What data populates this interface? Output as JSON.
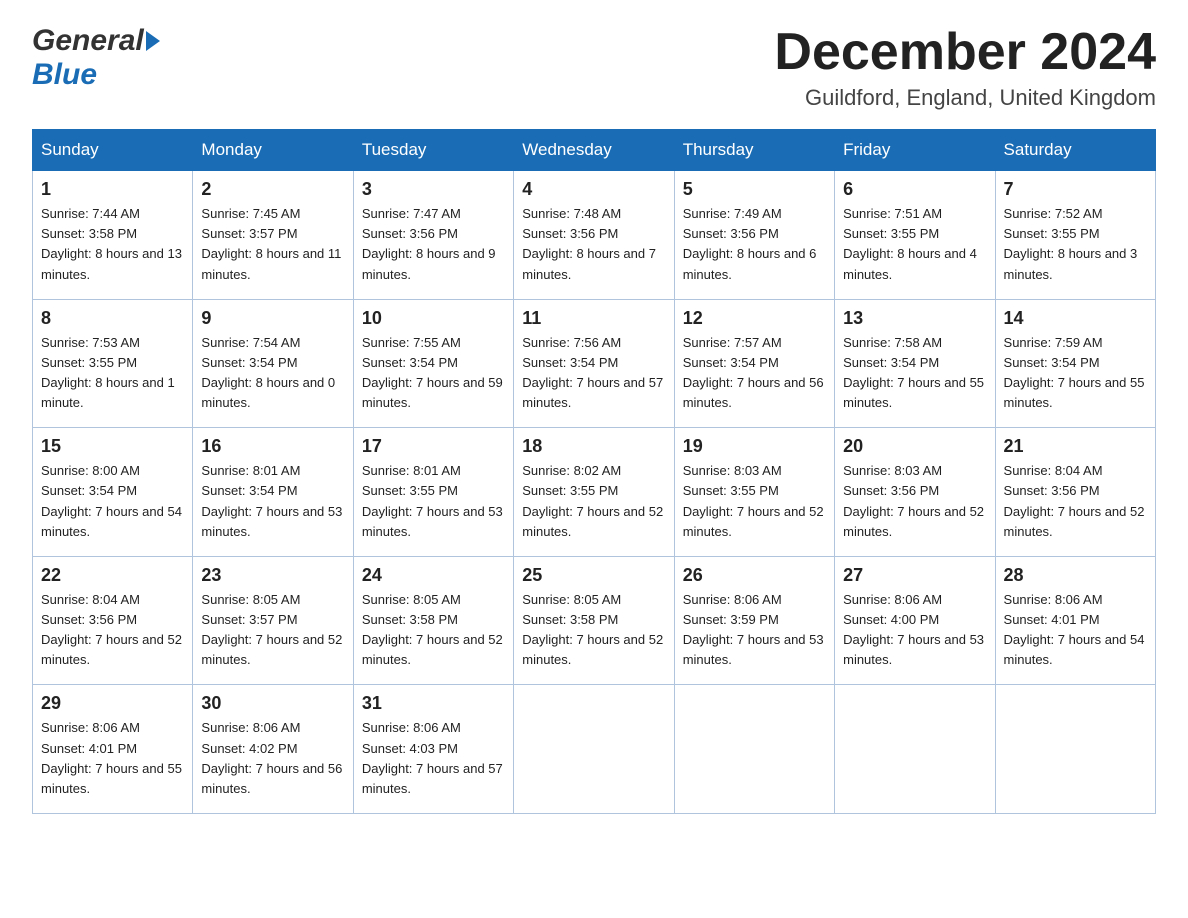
{
  "header": {
    "logo_general": "General",
    "logo_blue": "Blue",
    "month_title": "December 2024",
    "location": "Guildford, England, United Kingdom"
  },
  "weekdays": [
    "Sunday",
    "Monday",
    "Tuesday",
    "Wednesday",
    "Thursday",
    "Friday",
    "Saturday"
  ],
  "weeks": [
    [
      {
        "day": "1",
        "sunrise": "7:44 AM",
        "sunset": "3:58 PM",
        "daylight": "8 hours and 13 minutes."
      },
      {
        "day": "2",
        "sunrise": "7:45 AM",
        "sunset": "3:57 PM",
        "daylight": "8 hours and 11 minutes."
      },
      {
        "day": "3",
        "sunrise": "7:47 AM",
        "sunset": "3:56 PM",
        "daylight": "8 hours and 9 minutes."
      },
      {
        "day": "4",
        "sunrise": "7:48 AM",
        "sunset": "3:56 PM",
        "daylight": "8 hours and 7 minutes."
      },
      {
        "day": "5",
        "sunrise": "7:49 AM",
        "sunset": "3:56 PM",
        "daylight": "8 hours and 6 minutes."
      },
      {
        "day": "6",
        "sunrise": "7:51 AM",
        "sunset": "3:55 PM",
        "daylight": "8 hours and 4 minutes."
      },
      {
        "day": "7",
        "sunrise": "7:52 AM",
        "sunset": "3:55 PM",
        "daylight": "8 hours and 3 minutes."
      }
    ],
    [
      {
        "day": "8",
        "sunrise": "7:53 AM",
        "sunset": "3:55 PM",
        "daylight": "8 hours and 1 minute."
      },
      {
        "day": "9",
        "sunrise": "7:54 AM",
        "sunset": "3:54 PM",
        "daylight": "8 hours and 0 minutes."
      },
      {
        "day": "10",
        "sunrise": "7:55 AM",
        "sunset": "3:54 PM",
        "daylight": "7 hours and 59 minutes."
      },
      {
        "day": "11",
        "sunrise": "7:56 AM",
        "sunset": "3:54 PM",
        "daylight": "7 hours and 57 minutes."
      },
      {
        "day": "12",
        "sunrise": "7:57 AM",
        "sunset": "3:54 PM",
        "daylight": "7 hours and 56 minutes."
      },
      {
        "day": "13",
        "sunrise": "7:58 AM",
        "sunset": "3:54 PM",
        "daylight": "7 hours and 55 minutes."
      },
      {
        "day": "14",
        "sunrise": "7:59 AM",
        "sunset": "3:54 PM",
        "daylight": "7 hours and 55 minutes."
      }
    ],
    [
      {
        "day": "15",
        "sunrise": "8:00 AM",
        "sunset": "3:54 PM",
        "daylight": "7 hours and 54 minutes."
      },
      {
        "day": "16",
        "sunrise": "8:01 AM",
        "sunset": "3:54 PM",
        "daylight": "7 hours and 53 minutes."
      },
      {
        "day": "17",
        "sunrise": "8:01 AM",
        "sunset": "3:55 PM",
        "daylight": "7 hours and 53 minutes."
      },
      {
        "day": "18",
        "sunrise": "8:02 AM",
        "sunset": "3:55 PM",
        "daylight": "7 hours and 52 minutes."
      },
      {
        "day": "19",
        "sunrise": "8:03 AM",
        "sunset": "3:55 PM",
        "daylight": "7 hours and 52 minutes."
      },
      {
        "day": "20",
        "sunrise": "8:03 AM",
        "sunset": "3:56 PM",
        "daylight": "7 hours and 52 minutes."
      },
      {
        "day": "21",
        "sunrise": "8:04 AM",
        "sunset": "3:56 PM",
        "daylight": "7 hours and 52 minutes."
      }
    ],
    [
      {
        "day": "22",
        "sunrise": "8:04 AM",
        "sunset": "3:56 PM",
        "daylight": "7 hours and 52 minutes."
      },
      {
        "day": "23",
        "sunrise": "8:05 AM",
        "sunset": "3:57 PM",
        "daylight": "7 hours and 52 minutes."
      },
      {
        "day": "24",
        "sunrise": "8:05 AM",
        "sunset": "3:58 PM",
        "daylight": "7 hours and 52 minutes."
      },
      {
        "day": "25",
        "sunrise": "8:05 AM",
        "sunset": "3:58 PM",
        "daylight": "7 hours and 52 minutes."
      },
      {
        "day": "26",
        "sunrise": "8:06 AM",
        "sunset": "3:59 PM",
        "daylight": "7 hours and 53 minutes."
      },
      {
        "day": "27",
        "sunrise": "8:06 AM",
        "sunset": "4:00 PM",
        "daylight": "7 hours and 53 minutes."
      },
      {
        "day": "28",
        "sunrise": "8:06 AM",
        "sunset": "4:01 PM",
        "daylight": "7 hours and 54 minutes."
      }
    ],
    [
      {
        "day": "29",
        "sunrise": "8:06 AM",
        "sunset": "4:01 PM",
        "daylight": "7 hours and 55 minutes."
      },
      {
        "day": "30",
        "sunrise": "8:06 AM",
        "sunset": "4:02 PM",
        "daylight": "7 hours and 56 minutes."
      },
      {
        "day": "31",
        "sunrise": "8:06 AM",
        "sunset": "4:03 PM",
        "daylight": "7 hours and 57 minutes."
      },
      null,
      null,
      null,
      null
    ]
  ]
}
